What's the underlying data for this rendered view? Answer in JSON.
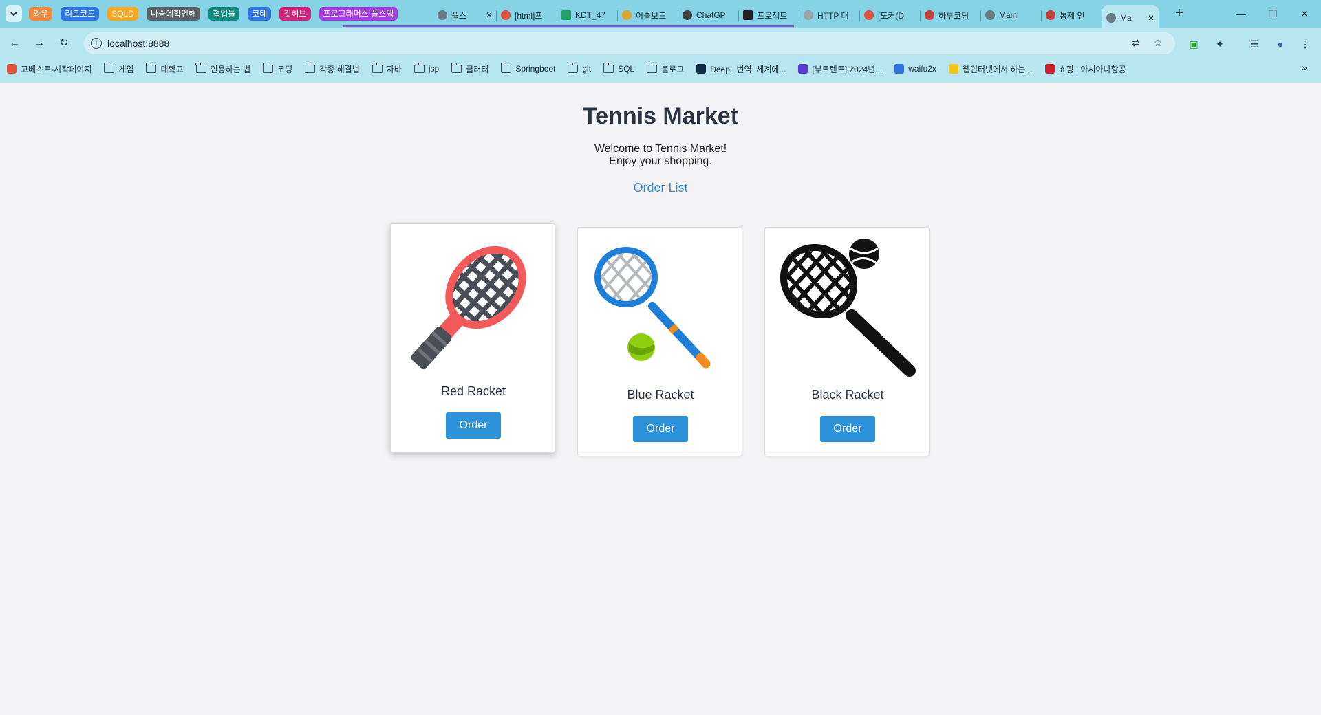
{
  "browser": {
    "tab_groups": [
      {
        "label": "와우",
        "color": "#f08a3c"
      },
      {
        "label": "리트코드",
        "color": "#2f74e0"
      },
      {
        "label": "SQLD",
        "color": "#f5a623"
      },
      {
        "label": "나중에확인해",
        "color": "#5a6268"
      },
      {
        "label": "협업툴",
        "color": "#0f8a7e"
      },
      {
        "label": "코테",
        "color": "#2f74e0"
      },
      {
        "label": "깃허브",
        "color": "#d0247c"
      },
      {
        "label": "프로그래머스 풀스택",
        "color": "#a23ee0"
      }
    ],
    "tabs": [
      {
        "label": "풀스",
        "color": "#6b7b83"
      },
      {
        "label": "[html]프",
        "color": "#e0523c"
      },
      {
        "label": "KDT_47",
        "color": "#1fa463"
      },
      {
        "label": "이슬보드",
        "color": "#d9a62e"
      },
      {
        "label": "ChatGP",
        "color": "#444444"
      },
      {
        "label": "프로젝트",
        "color": "#222222"
      },
      {
        "label": "HTTP 대",
        "color": "#9aa3a8"
      },
      {
        "label": "[도커(D",
        "color": "#e0523c"
      },
      {
        "label": "하루코딩",
        "color": "#c9403a"
      },
      {
        "label": "Main",
        "color": "#6b7b83"
      },
      {
        "label": "통제 인",
        "color": "#c9403a"
      }
    ],
    "active_tab": {
      "label": "Ma"
    },
    "url": "localhost:8888",
    "bookmarks": [
      {
        "label": "고베스트-시작페이지",
        "type": "site",
        "color": "#e0523c"
      },
      {
        "label": "게임",
        "type": "folder"
      },
      {
        "label": "대학교",
        "type": "folder"
      },
      {
        "label": "인용하는 법",
        "type": "folder"
      },
      {
        "label": "코딩",
        "type": "folder"
      },
      {
        "label": "각종 해결법",
        "type": "folder"
      },
      {
        "label": "자바",
        "type": "folder"
      },
      {
        "label": "jsp",
        "type": "folder"
      },
      {
        "label": "클러터",
        "type": "folder"
      },
      {
        "label": "Springboot",
        "type": "folder"
      },
      {
        "label": "git",
        "type": "folder"
      },
      {
        "label": "SQL",
        "type": "folder"
      },
      {
        "label": "블로그",
        "type": "folder"
      },
      {
        "label": "DeepL 번역: 세계에...",
        "type": "site",
        "color": "#0f2b46"
      },
      {
        "label": "[부트텐트] 2024년...",
        "type": "site",
        "color": "#5b3bd6"
      },
      {
        "label": "waifu2x",
        "type": "site",
        "color": "#2f74e0"
      },
      {
        "label": "웹인터넷에서 하는...",
        "type": "site",
        "color": "#f5c518"
      },
      {
        "label": "쇼핑 | 아시아나항공",
        "type": "site",
        "color": "#d0202c"
      }
    ]
  },
  "page": {
    "title": "Tennis Market",
    "welcome_line1": "Welcome to Tennis Market!",
    "welcome_line2": "Enjoy your shopping.",
    "order_list_link": "Order List",
    "products": [
      {
        "name": "Red Racket",
        "button": "Order",
        "image": "red-racket-icon"
      },
      {
        "name": "Blue Racket",
        "button": "Order",
        "image": "blue-racket-icon"
      },
      {
        "name": "Black Racket",
        "button": "Order",
        "image": "black-racket-icon"
      }
    ]
  }
}
